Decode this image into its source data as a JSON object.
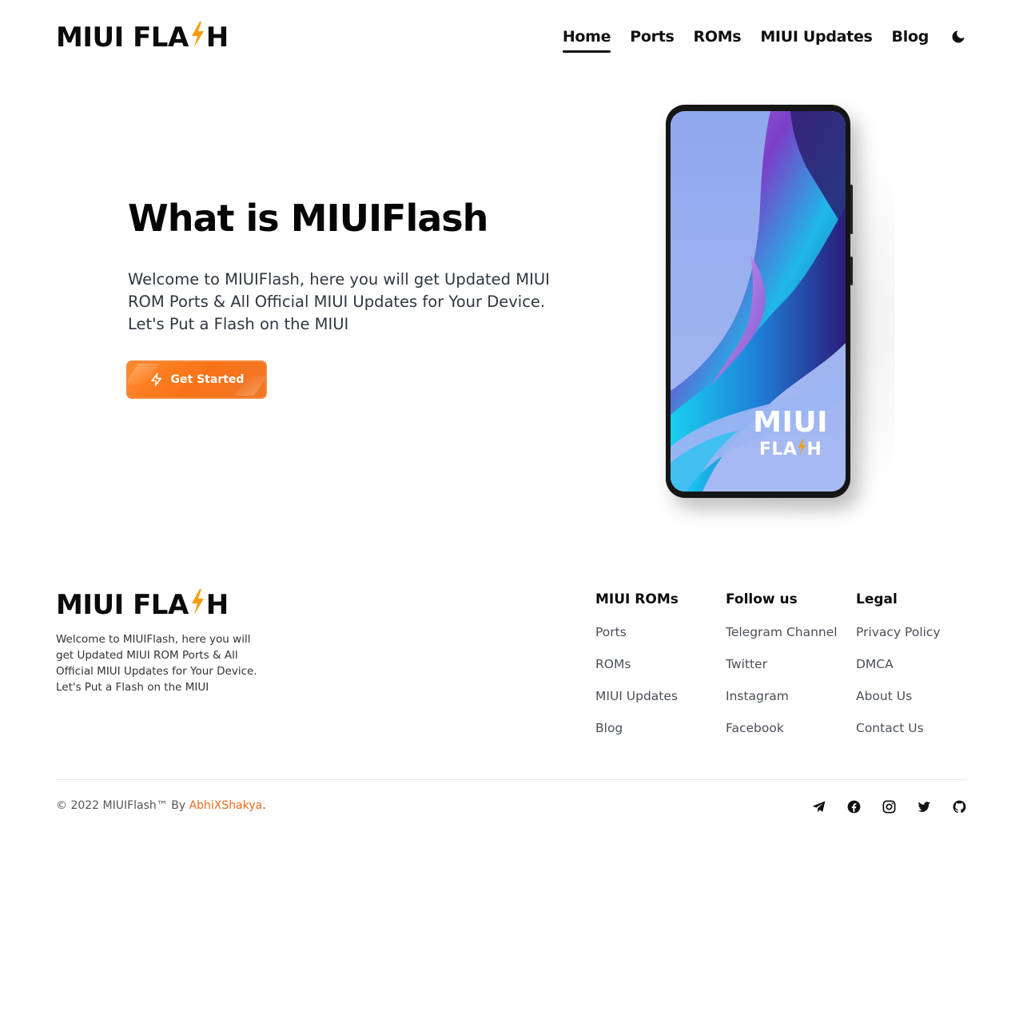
{
  "brand": {
    "logo_left": "MIUI FLA",
    "logo_right": "H",
    "accent_color": "#f97316",
    "bolt_color": "#f59e0b"
  },
  "nav": {
    "items": [
      {
        "label": "Home",
        "active": true
      },
      {
        "label": "Ports",
        "active": false
      },
      {
        "label": "ROMs",
        "active": false
      },
      {
        "label": "MIUI Updates",
        "active": false
      },
      {
        "label": "Blog",
        "active": false
      }
    ],
    "theme_icon": "moon-icon"
  },
  "hero": {
    "title": "What is MIUIFlash",
    "description": "Welcome to MIUIFlash, here you will get Updated MIUI ROM Ports & All Official MIUI Updates for Your Device. Let's Put a Flash on the MIUI",
    "cta_label": "Get Started",
    "cta_icon": "bolt-icon"
  },
  "phone": {
    "screen_line1": "MIUI",
    "screen_line2_left": "FLA",
    "screen_line2_right": "H"
  },
  "footer": {
    "description": "Welcome to MIUIFlash, here you will get Updated MIUI ROM Ports & All Official MIUI Updates for Your Device. Let's Put a Flash on the MIUI",
    "columns": [
      {
        "title": "MIUI ROMs",
        "links": [
          "Ports",
          "ROMs",
          "MIUI Updates",
          "Blog"
        ]
      },
      {
        "title": "Follow us",
        "links": [
          "Telegram Channel",
          "Twitter",
          "Instagram",
          "Facebook"
        ]
      },
      {
        "title": "Legal",
        "links": [
          "Privacy Policy",
          "DMCA",
          "About Us",
          "Contact Us"
        ]
      }
    ],
    "copyright_prefix": "© 2022 MIUIFlash™ By ",
    "copyright_author": "AbhiXShakya",
    "copyright_suffix": ".",
    "social_icons": [
      "telegram-icon",
      "facebook-icon",
      "instagram-icon",
      "twitter-icon",
      "github-icon"
    ]
  }
}
